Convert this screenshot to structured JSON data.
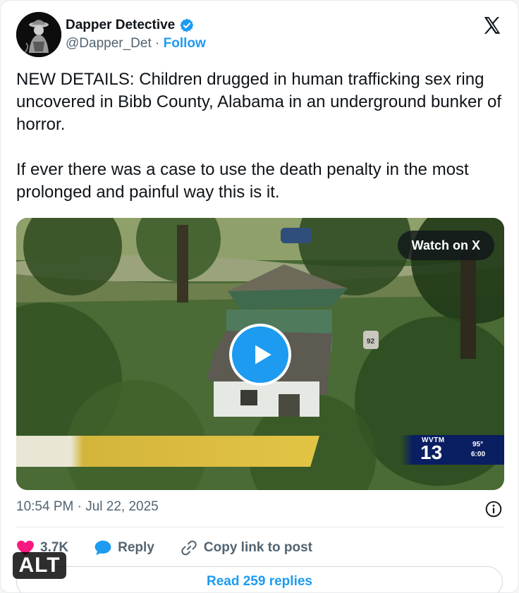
{
  "author": {
    "display_name": "Dapper Detective",
    "handle": "@Dapper_Det",
    "separator": " · ",
    "follow_label": "Follow"
  },
  "tweet": {
    "text": "NEW DETAILS: Children drugged in human trafficking sex ring uncovered in Bibb County, Alabama in an underground bunker of horror.\n\nIf ever there was a case to use the death penalty in the most prolonged and painful way this is it.",
    "timestamp": "10:54 PM · Jul 22, 2025"
  },
  "media": {
    "watch_label": "Watch on X",
    "station_call": "WVTM",
    "station_number": "13",
    "temperature": "95°",
    "clock": "6:00",
    "house_number": "92"
  },
  "actions": {
    "likes_count": "3.7K",
    "reply_label": "Reply",
    "copy_label": "Copy link to post"
  },
  "read_replies_label": "Read 259 replies",
  "alt_badge": "ALT",
  "icons": {
    "verified": "verified-badge-icon",
    "x_logo": "x-logo-icon",
    "play": "play-icon",
    "info": "info-icon",
    "heart": "heart-icon",
    "reply": "speech-bubble-icon",
    "link": "link-icon"
  },
  "colors": {
    "accent": "#1d9bf0",
    "like": "#f91880",
    "muted_text": "#536471"
  }
}
